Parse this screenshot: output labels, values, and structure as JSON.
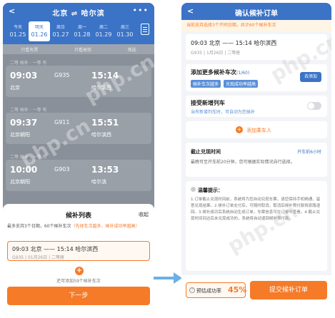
{
  "left": {
    "header": {
      "back_icon": "chevron-left-icon",
      "title": "北京 ⇌ 哈尔滨",
      "more_icon": "more-icon"
    },
    "dates": [
      {
        "weekday": "今天",
        "date": "01.25"
      },
      {
        "weekday": "明天",
        "date": "01.26"
      },
      {
        "weekday": "周日",
        "date": "01.27"
      },
      {
        "weekday": "周一",
        "date": "01.28"
      },
      {
        "weekday": "周二",
        "date": "01.29"
      },
      {
        "weekday": "周三",
        "date": "01.30"
      }
    ],
    "active_date_index": 1,
    "filters": [
      "只看有票",
      "只看高铁",
      "筛选"
    ],
    "trains": [
      {
        "dep": "09:03",
        "num": "G935",
        "arr": "15:14",
        "from": "北京",
        "to": "哈尔滨西",
        "seats": "二等 候补 · 一等 有"
      },
      {
        "dep": "09:37",
        "num": "G911",
        "arr": "15:51",
        "from": "北京朝阳",
        "to": "哈尔滨西",
        "seats": "二等 候补 · 一等 有"
      },
      {
        "dep": "10:00",
        "num": "G903",
        "arr": "13:53",
        "from": "北京朝阳",
        "to": "哈尔滨",
        "seats": "二等 候补 · 一等 有"
      }
    ],
    "sheet": {
      "title": "候补列表",
      "collapse": "收起",
      "hint_prefix": "最多支持3个日期，60个候补车次",
      "hint_orange": "（先择车次越多，候补成功率越高）",
      "chosen_title": "09:03 北京 —— 15:14 哈尔滨西",
      "chosen_sub": "G935 | 01月26日 | 二等座",
      "add_note": "还可添加59个候补车次",
      "next": "下一步"
    }
  },
  "right": {
    "header": {
      "back_icon": "chevron-left-icon",
      "title": "确认候补订单"
    },
    "notice": "当前支持选择3个不同日期，共计60个候补车次",
    "order": {
      "title": "09:03 北京 —— 15:14 哈尔滨西",
      "sub": "G935 | 1月26日 | 二等座"
    },
    "add_more": {
      "title": "添加更多候补车次",
      "count": "(1/60)",
      "tags": [
        "候补车次越多",
        "兑现成功率越高"
      ],
      "button": "去添加"
    },
    "new_train": {
      "title": "接受新增列车",
      "sub": "当有新增列车时，可自动为您候补"
    },
    "add_passenger": "添加乘车人",
    "deadline": {
      "title": "截止兑现时间",
      "right": "开车前6小时",
      "sub": "最晚可至开车前20分钟，您可根据实际情况自行选择。"
    },
    "notes": {
      "title": "温馨提示：",
      "body": "1.订单截止兑现时间前，系统将为您自动兑现车票，请您保持手机畅通，留意兑现结果。2.候补订单支付后，可随时取消，取消后候补预付款将原路退回。3.候补成功后系统自动生成订单，车票信息可在订单中查看。4.截止兑现时间到达后未兑现成功的，系统将自动退回候补预付款。"
    },
    "footer": {
      "rate_label": "预估成功率",
      "rate_value": "45%",
      "submit": "提交候补订单"
    }
  }
}
